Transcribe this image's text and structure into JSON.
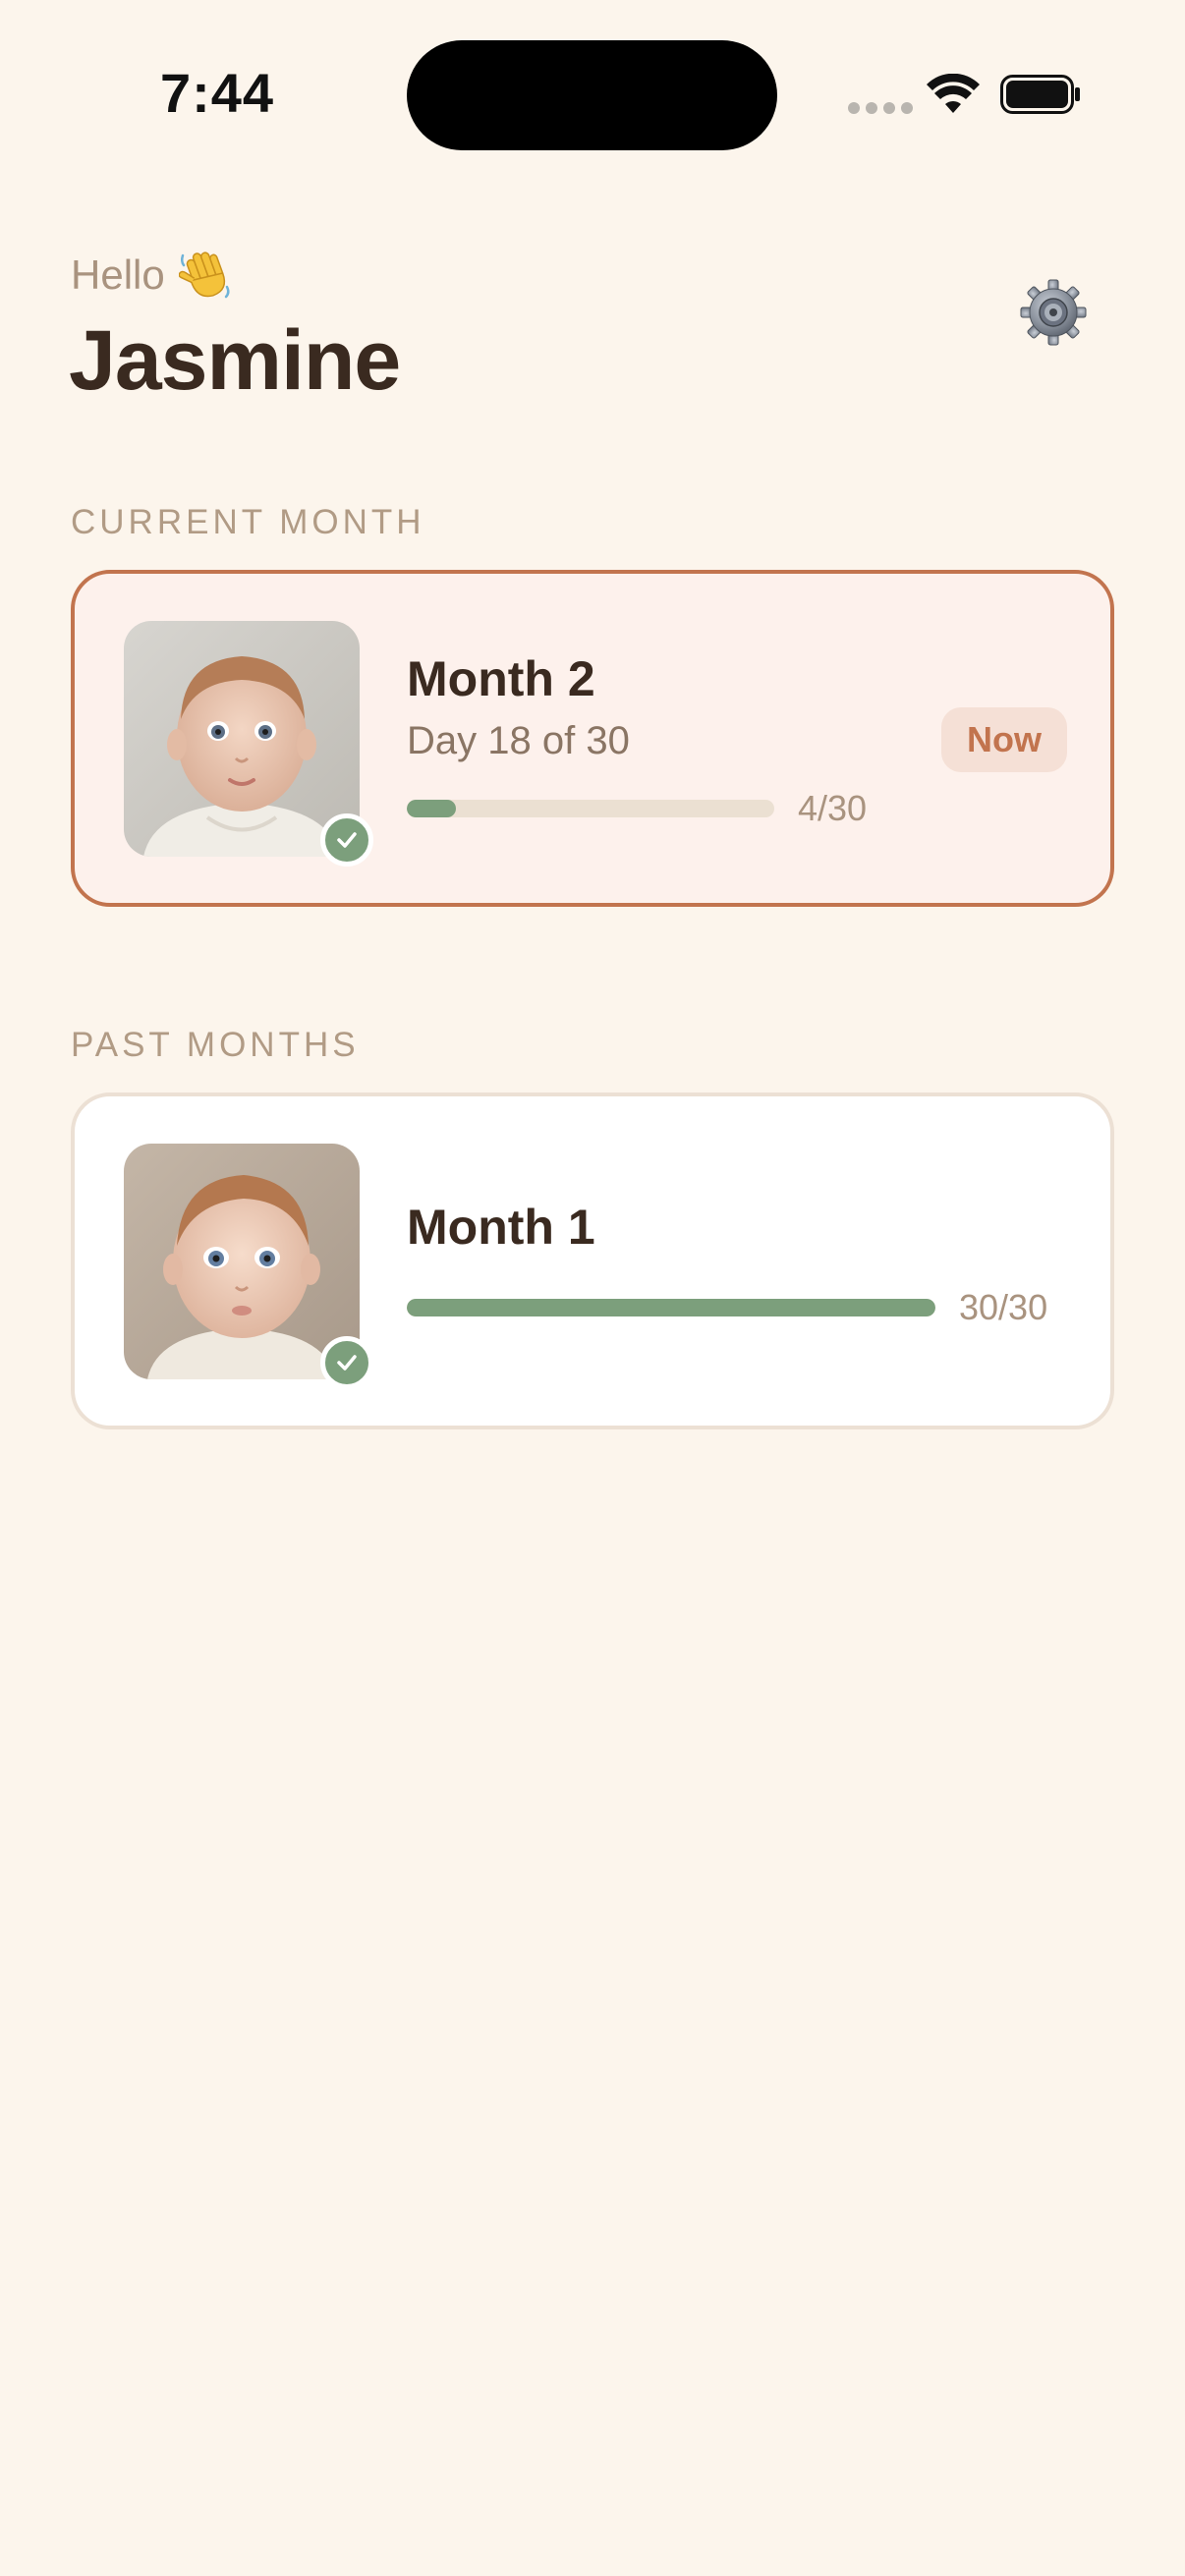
{
  "status_bar": {
    "time": "7:44"
  },
  "header": {
    "greeting": "Hello",
    "greeting_icon": "waving-hand-icon",
    "name": "Jasmine",
    "settings_icon": "gear-icon"
  },
  "sections": {
    "current_label": "CURRENT MONTH",
    "past_label": "PAST MONTHS"
  },
  "current_month": {
    "title": "Month 2",
    "day_text": "Day 18 of 30",
    "badge": "Now",
    "progress_text": "4/30",
    "progress_fraction": 0.133,
    "completed": true
  },
  "past_months": [
    {
      "title": "Month 1",
      "progress_text": "30/30",
      "progress_fraction": 1.0,
      "completed": true
    }
  ],
  "colors": {
    "background": "#fcf5ec",
    "accent": "#c2744e",
    "success": "#7c9f7c",
    "text_primary": "#3a2a20",
    "text_muted": "#a9937f"
  }
}
